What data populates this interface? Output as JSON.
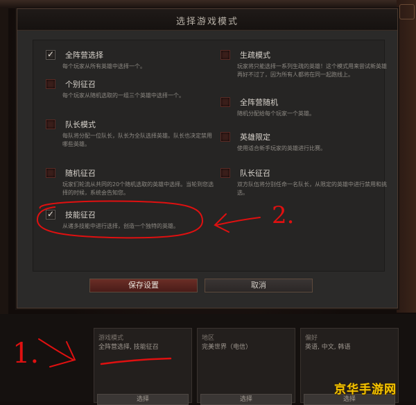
{
  "dialog": {
    "title": "选择游戏模式",
    "modes": [
      {
        "name": "全阵营选择",
        "desc": "每个玩家从所有英雄中选择一个。",
        "checked": true
      },
      {
        "name": "个别征召",
        "desc": "每个玩家从随机选取的一组三个英雄中选择一个。",
        "checked": false
      },
      {
        "name": "队长模式",
        "desc": "每队将分配一位队长，队长为全队选择英雄。队长也决定禁用哪些英雄。",
        "checked": false
      },
      {
        "name": "随机征召",
        "desc": "玩家们轮流从共同的20个随机选取的英雄中选择。当轮到您选择的时候，系统会告知您。",
        "checked": false
      },
      {
        "name": "技能征召",
        "desc": "从诸多技能中进行选择，创造一个独特的英雄。",
        "checked": true
      },
      {
        "name": "生疏模式",
        "desc": "玩家将只能选择一系列生疏的英雄！这个模式用来尝试新英雄再好不过了，因为所有人都将在同一起跑线上。",
        "checked": false
      },
      {
        "name": "全阵营随机",
        "desc": "随机分配给每个玩家一个英雄。",
        "checked": false
      },
      {
        "name": "英雄限定",
        "desc": "使用适合新手玩家的英雄进行比赛。",
        "checked": false
      },
      {
        "name": "队长征召",
        "desc": "双方队伍将分别任命一名队长，从限定的英雄中进行禁用和挑选。",
        "checked": false
      }
    ],
    "save_label": "保存设置",
    "cancel_label": "取消"
  },
  "lobby": {
    "cards": [
      {
        "label": "游戏模式",
        "value": "全阵营选择, 技能征召",
        "button": "选择"
      },
      {
        "label": "地区",
        "value": "完美世界（电信）",
        "button": "选择"
      },
      {
        "label": "偏好",
        "value": "英语, 中文, 韩语",
        "button": "选择"
      }
    ]
  },
  "annotations": {
    "arrow_one_label": "1.",
    "arrow_two_label": "2.",
    "color": "#e01010"
  },
  "watermark": "京华手游网",
  "colors": {
    "dialog_bg": "#2b2a29",
    "save_button": "#6a2e26",
    "annotation_red": "#e01010",
    "watermark_yellow": "#f5c400"
  }
}
